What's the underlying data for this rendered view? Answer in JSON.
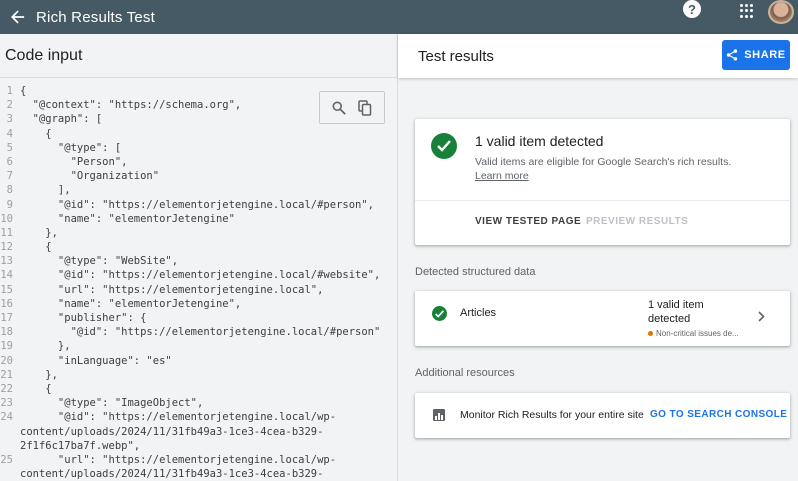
{
  "app": {
    "title": "Rich Results Test"
  },
  "left": {
    "title": "Code input",
    "code_lines": [
      {
        "n": "1",
        "t": "{"
      },
      {
        "n": "2",
        "t": "  \"@context\": \"https://schema.org\","
      },
      {
        "n": "3",
        "t": "  \"@graph\": ["
      },
      {
        "n": "4",
        "t": "    {"
      },
      {
        "n": "5",
        "t": "      \"@type\": ["
      },
      {
        "n": "6",
        "t": "        \"Person\","
      },
      {
        "n": "7",
        "t": "        \"Organization\""
      },
      {
        "n": "8",
        "t": "      ],"
      },
      {
        "n": "9",
        "t": "      \"@id\": \"https://elementorjetengine.local/#person\","
      },
      {
        "n": "10",
        "t": "      \"name\": \"elementorJetengine\""
      },
      {
        "n": "11",
        "t": "    },"
      },
      {
        "n": "12",
        "t": "    {"
      },
      {
        "n": "13",
        "t": "      \"@type\": \"WebSite\","
      },
      {
        "n": "14",
        "t": "      \"@id\": \"https://elementorjetengine.local/#website\","
      },
      {
        "n": "15",
        "t": "      \"url\": \"https://elementorjetengine.local\","
      },
      {
        "n": "16",
        "t": "      \"name\": \"elementorJetengine\","
      },
      {
        "n": "17",
        "t": "      \"publisher\": {"
      },
      {
        "n": "18",
        "t": "        \"@id\": \"https://elementorjetengine.local/#person\""
      },
      {
        "n": "19",
        "t": "      },"
      },
      {
        "n": "20",
        "t": "      \"inLanguage\": \"es\""
      },
      {
        "n": "21",
        "t": "    },"
      },
      {
        "n": "22",
        "t": "    {"
      },
      {
        "n": "23",
        "t": "      \"@type\": \"ImageObject\","
      },
      {
        "n": "24",
        "t": "      \"@id\": \"https://elementorjetengine.local/wp-"
      },
      {
        "n": "",
        "t": "content/uploads/2024/11/31fb49a3-1ce3-4cea-b329-"
      },
      {
        "n": "",
        "t": "2f1f6c17ba7f.webp\","
      },
      {
        "n": "25",
        "t": "      \"url\": \"https://elementorjetengine.local/wp-"
      },
      {
        "n": "",
        "t": "content/uploads/2024/11/31fb49a3-1ce3-4cea-b329-"
      }
    ]
  },
  "right": {
    "title": "Test results",
    "share_label": "SHARE",
    "summary": {
      "headline": "1 valid item detected",
      "subtext": "Valid items are eligible for Google Search's rich results.",
      "learn_more": "Learn more",
      "view_tested_page": "VIEW TESTED PAGE",
      "preview_results": "PREVIEW RESULTS"
    },
    "detected_label": "Detected structured data",
    "articles": {
      "name": "Articles",
      "status": "1 valid item detected",
      "warning": "Non-critical issues de..."
    },
    "additional_label": "Additional resources",
    "monitor": {
      "text": "Monitor Rich Results for your entire site",
      "link": "GO TO SEARCH CONSOLE"
    }
  },
  "colors": {
    "topbar": "#455a64",
    "accent": "#1a73e8",
    "valid": "#188038",
    "warning": "#e37400"
  }
}
